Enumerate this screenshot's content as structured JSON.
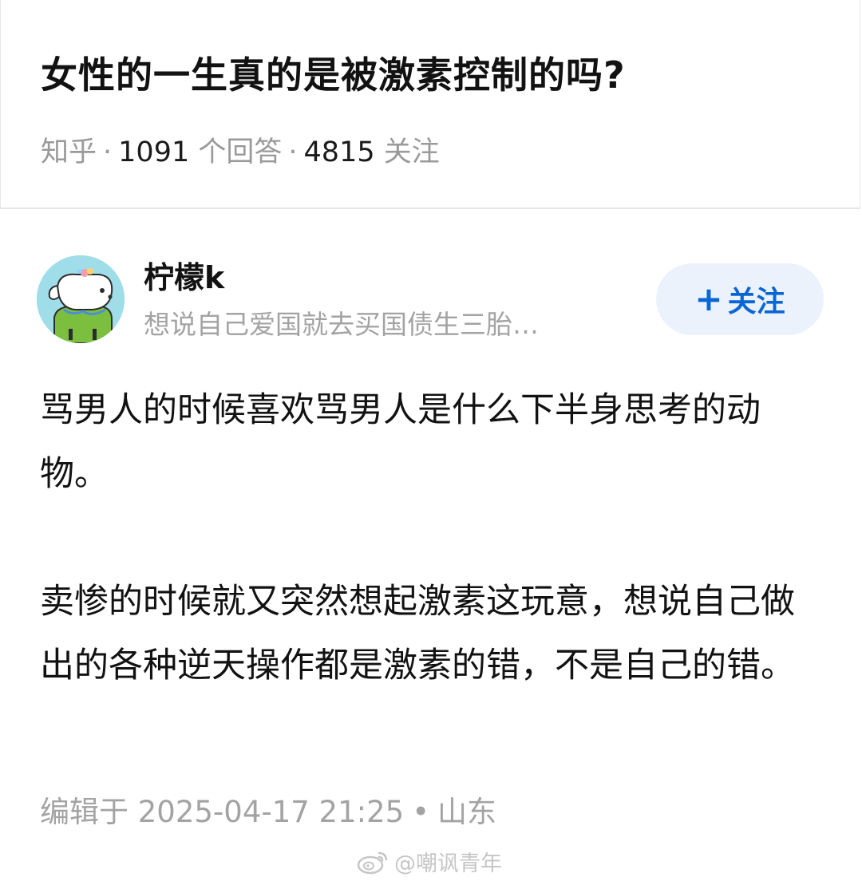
{
  "question": {
    "title": "女性的一生真的是被激素控制的吗?",
    "source": "知乎",
    "answer_count": "1091",
    "answer_label": "个回答",
    "follow_count": "4815",
    "follow_label": "关注"
  },
  "author": {
    "name": "柠檬k",
    "bio": "想说自己爱国就去买国债生三胎…",
    "follow_button": "关注",
    "avatar_icon": "cartoon-dog-avatar"
  },
  "answer": {
    "paragraphs": [
      "骂男人的时候喜欢骂男人是什么下半身思考的动物。",
      "卖惨的时候就又突然想起激素这玩意，想说自己做出的各种逆天操作都是激素的错，不是自己的错。"
    ]
  },
  "edit_info": {
    "label": "编辑于 2025-04-17 21:25",
    "location": "山东"
  },
  "watermark": {
    "text": "@嘲讽青年",
    "icon": "weibo-icon"
  },
  "colors": {
    "accent": "#0a66d4",
    "follow_bg": "#ebf2fc",
    "meta_gray": "#9a9a9a",
    "text": "#121212"
  }
}
